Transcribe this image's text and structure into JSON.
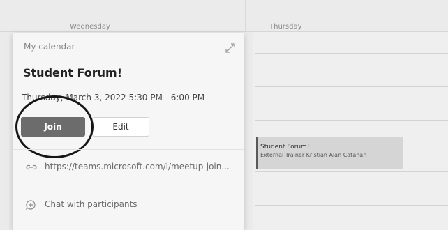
{
  "calendar": {
    "day_headers": [
      "Wednesday",
      "Thursday"
    ]
  },
  "event_card": {
    "calendar_name": "My calendar",
    "title": "Student Forum!",
    "datetime": "Thursday, March 3, 2022 5:30 PM - 6:00 PM",
    "join_label": "Join",
    "edit_label": "Edit",
    "meeting_link": "https://teams.microsoft.com/l/meetup-join...",
    "chat_label": "Chat with participants"
  },
  "event_block": {
    "title": "Student Forum!",
    "subtitle": "External Trainer Kristian Alan Catahan"
  },
  "colors": {
    "join_button": "#6c6c6c",
    "annotation_circle": "#161616",
    "event_accent": "#5a5a5a"
  },
  "icons": {
    "expand": "expand-icon",
    "link": "link-icon",
    "chat": "chat-icon"
  }
}
